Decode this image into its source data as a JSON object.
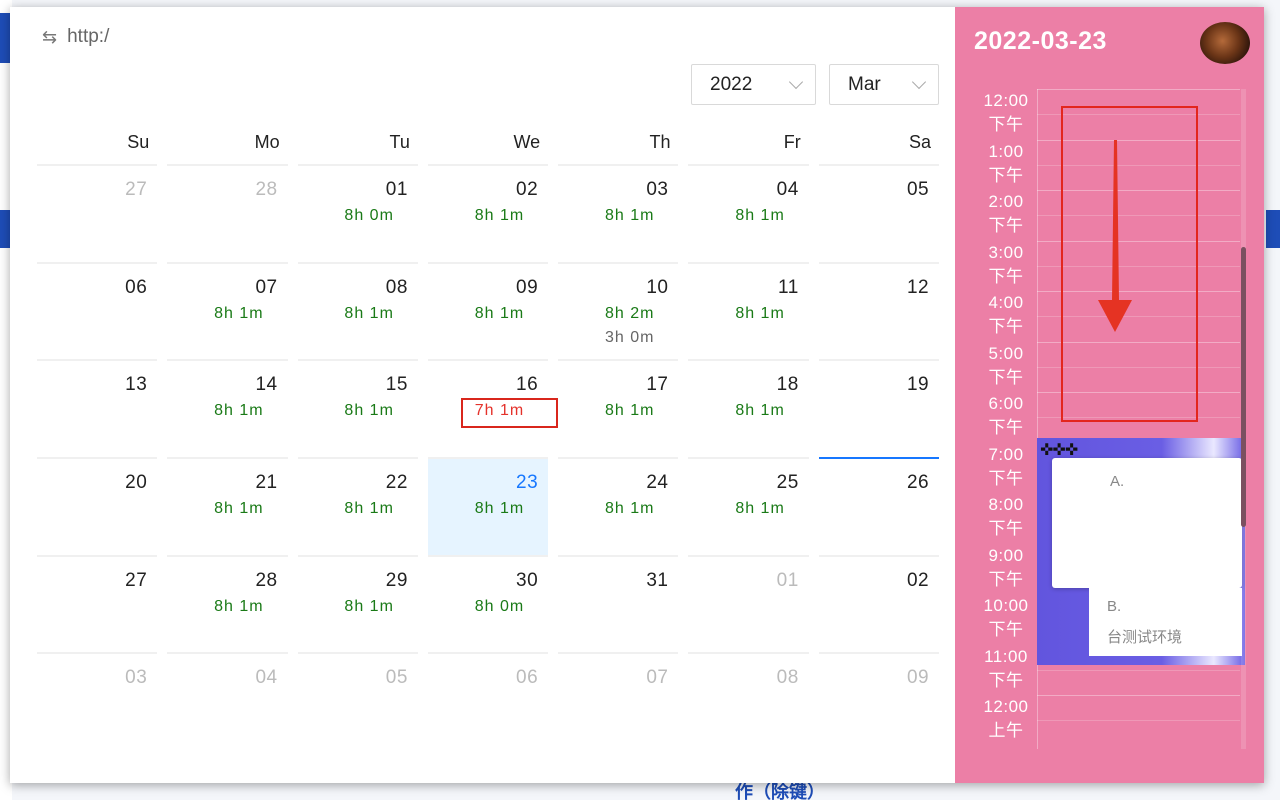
{
  "url": "http:/",
  "year_select": {
    "value": "2022"
  },
  "month_select": {
    "value": "Mar"
  },
  "weekdays": [
    "Su",
    "Mo",
    "Tu",
    "We",
    "Th",
    "Fr",
    "Sa"
  ],
  "weeks": [
    [
      {
        "d": "27",
        "out": true
      },
      {
        "d": "28",
        "out": true
      },
      {
        "d": "01",
        "h": [
          "8h 0m"
        ]
      },
      {
        "d": "02",
        "h": [
          "8h 1m"
        ]
      },
      {
        "d": "03",
        "h": [
          "8h 1m"
        ]
      },
      {
        "d": "04",
        "h": [
          "8h 1m"
        ]
      },
      {
        "d": "05"
      }
    ],
    [
      {
        "d": "06"
      },
      {
        "d": "07",
        "h": [
          "8h 1m"
        ]
      },
      {
        "d": "08",
        "h": [
          "8h 1m"
        ]
      },
      {
        "d": "09",
        "h": [
          "8h 1m"
        ]
      },
      {
        "d": "10",
        "h": [
          "8h 2m",
          "3h 0m"
        ]
      },
      {
        "d": "11",
        "h": [
          "8h 1m"
        ]
      },
      {
        "d": "12"
      }
    ],
    [
      {
        "d": "13"
      },
      {
        "d": "14",
        "h": [
          "8h 1m"
        ]
      },
      {
        "d": "15",
        "h": [
          "8h 1m"
        ]
      },
      {
        "d": "16",
        "h": [
          "7h 1m"
        ],
        "warn": true
      },
      {
        "d": "17",
        "h": [
          "8h 1m"
        ]
      },
      {
        "d": "18",
        "h": [
          "8h 1m"
        ]
      },
      {
        "d": "19"
      }
    ],
    [
      {
        "d": "20"
      },
      {
        "d": "21",
        "h": [
          "8h 1m"
        ]
      },
      {
        "d": "22",
        "h": [
          "8h 1m"
        ]
      },
      {
        "d": "23",
        "h": [
          "8h 1m"
        ],
        "today": true
      },
      {
        "d": "24",
        "h": [
          "8h 1m"
        ]
      },
      {
        "d": "25",
        "h": [
          "8h 1m"
        ]
      },
      {
        "d": "26",
        "selected": true
      }
    ],
    [
      {
        "d": "27"
      },
      {
        "d": "28",
        "h": [
          "8h 1m"
        ]
      },
      {
        "d": "29",
        "h": [
          "8h 1m"
        ]
      },
      {
        "d": "30",
        "h": [
          "8h 0m"
        ]
      },
      {
        "d": "31"
      },
      {
        "d": "01",
        "out": true
      },
      {
        "d": "02"
      }
    ],
    [
      {
        "d": "03",
        "out": true
      },
      {
        "d": "04",
        "out": true
      },
      {
        "d": "05",
        "out": true
      },
      {
        "d": "06",
        "out": true
      },
      {
        "d": "07",
        "out": true
      },
      {
        "d": "08",
        "out": true
      },
      {
        "d": "09",
        "out": true
      }
    ]
  ],
  "panel": {
    "date": "2022-03-23",
    "slots": [
      {
        "time": "12:00",
        "period": "下午"
      },
      {
        "time": "1:00",
        "period": "下午"
      },
      {
        "time": "2:00",
        "period": "下午"
      },
      {
        "time": "3:00",
        "period": "下午"
      },
      {
        "time": "4:00",
        "period": "下午"
      },
      {
        "time": "5:00",
        "period": "下午"
      },
      {
        "time": "6:00",
        "period": "下午"
      },
      {
        "time": "7:00",
        "period": "下午"
      },
      {
        "time": "8:00",
        "period": "下午"
      },
      {
        "time": "9:00",
        "period": "下午"
      },
      {
        "time": "10:00",
        "period": "下午"
      },
      {
        "time": "11:00",
        "period": "下午"
      },
      {
        "time": "12:00",
        "period": "上午"
      }
    ],
    "event": {
      "marker": "✜✜✜",
      "line_a": "A.",
      "line_b": "B.",
      "line_c": "台测试环境"
    }
  },
  "colors": {
    "panel_bg": "#ec7fa6",
    "event_bg": "#6255de",
    "accent": "#1677ff",
    "ok": "#1a7a17",
    "warn": "#e4322b"
  },
  "background_page": {
    "bottom_text": "作（除键）"
  }
}
